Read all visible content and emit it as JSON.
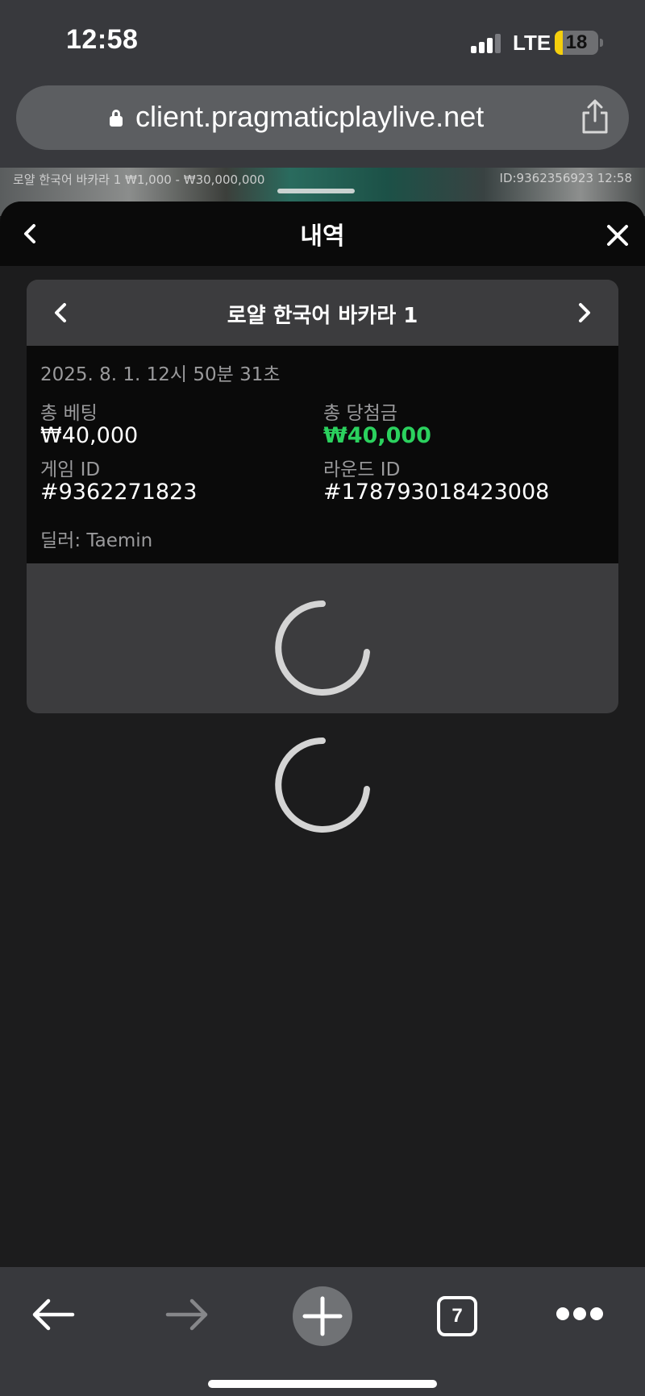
{
  "status_bar": {
    "time": "12:58",
    "network": "LTE",
    "battery_level": "18",
    "battery_percent": 18
  },
  "browser": {
    "url": "client.pragmaticplaylive.net",
    "open_tabs": "7"
  },
  "game_strip": {
    "left_info": "로얄 한국어 바카라 1  ₩1,000 - ₩30,000,000",
    "right_info": "ID:9362356923  12:58"
  },
  "sheet": {
    "title": "내역"
  },
  "record": {
    "game_name": "로얄 한국어 바카라 1",
    "datetime": "2025. 8. 1. 12시 50분 31초",
    "total_bet_label": "총 베팅",
    "total_bet_value": "₩40,000",
    "total_win_label": "총 당첨금",
    "total_win_value": "₩40,000",
    "game_id_label": "게임 ID",
    "game_id_value": "#9362271823",
    "round_id_label": "라운드 ID",
    "round_id_value": "#178793018423008",
    "dealer": "딜러: Taemin"
  },
  "colors": {
    "win_green": "#2bd15e",
    "battery_yellow": "#f5cf0c",
    "sheet_bg": "#1c1c1d",
    "card_bg": "#3c3c3e"
  }
}
